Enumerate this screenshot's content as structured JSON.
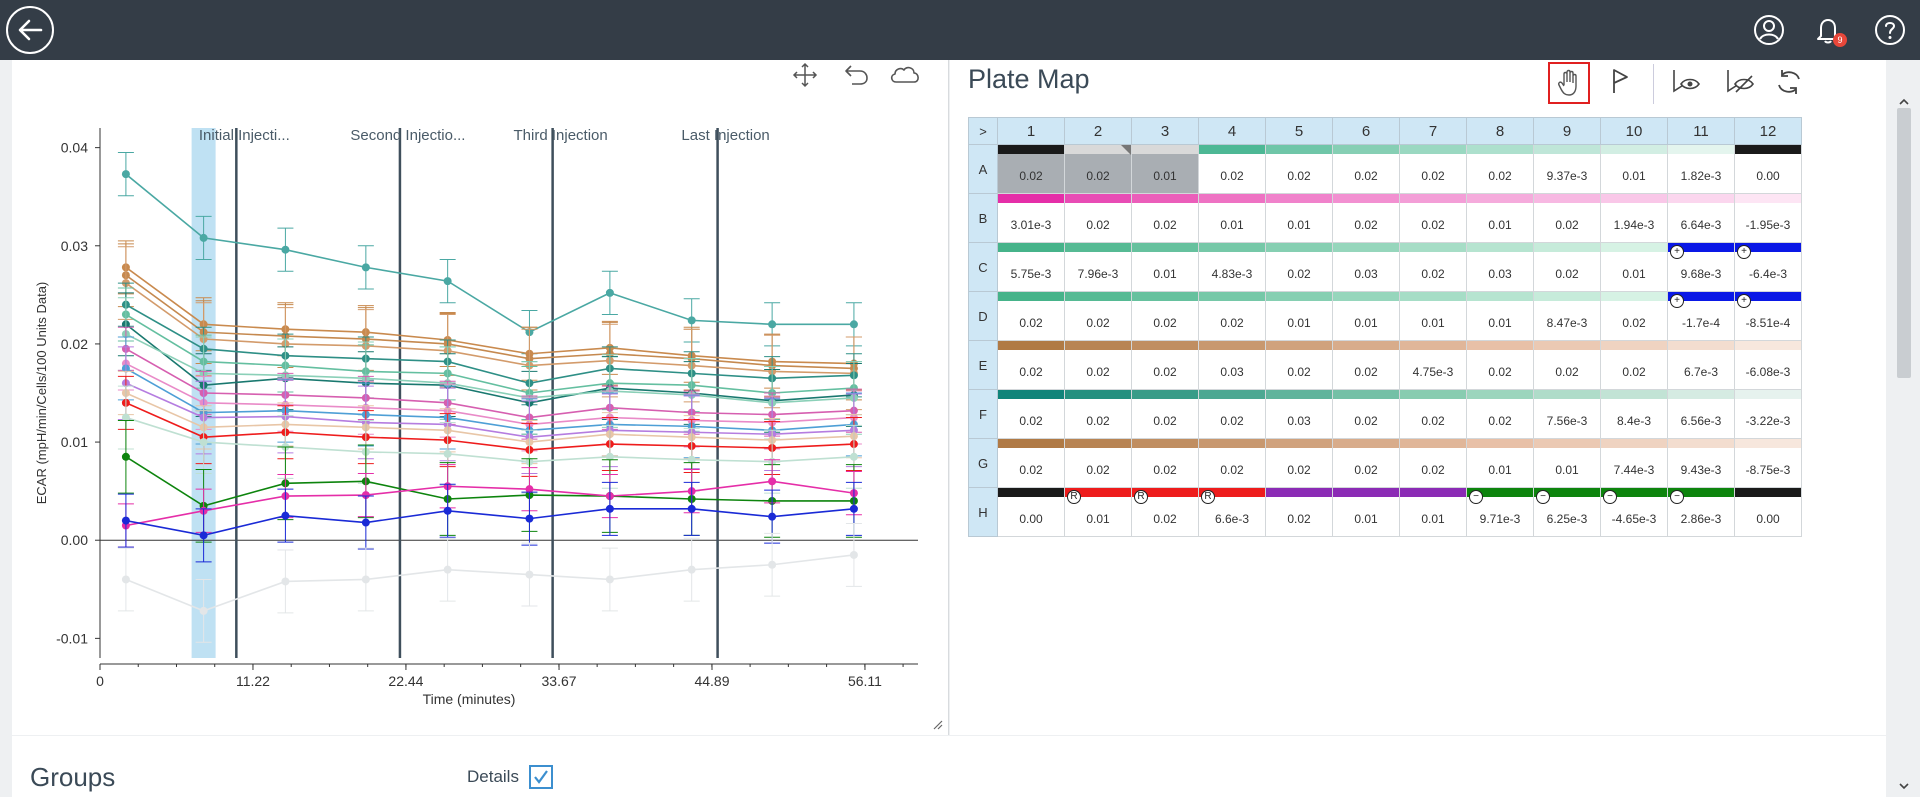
{
  "header": {
    "notification_count": "9"
  },
  "chart_toolbar": {
    "icons": [
      "move-icon",
      "undo-icon",
      "cloud-icon"
    ]
  },
  "plate_map": {
    "title": "Plate Map",
    "tools": [
      "hand-icon",
      "flag-icon",
      "show-icon",
      "hide-icon",
      "refresh-icon"
    ],
    "corner": ">",
    "columns": [
      "1",
      "2",
      "3",
      "4",
      "5",
      "6",
      "7",
      "8",
      "9",
      "10",
      "11",
      "12"
    ],
    "rows": [
      {
        "label": "A",
        "values": [
          "0.02",
          "0.02",
          "0.01",
          "0.02",
          "0.02",
          "0.02",
          "0.02",
          "0.02",
          "9.37e-3",
          "0.01",
          "1.82e-3",
          "0.00"
        ],
        "colors": [
          "#1a1a1a",
          "#d9d9d9",
          "#d9d9d9",
          "#4db895",
          "#6fc6a8",
          "#86cfb4",
          "#9ad8c1",
          "#ade0cd",
          "#bfe6d8",
          "#d2eee3",
          "#e4f5ee",
          "#1a1a1a"
        ]
      },
      {
        "label": "B",
        "values": [
          "3.01e-3",
          "0.02",
          "0.02",
          "0.01",
          "0.01",
          "0.02",
          "0.02",
          "0.01",
          "0.02",
          "1.94e-3",
          "6.64e-3",
          "-1.95e-3"
        ],
        "colors": [
          "#e52ea8",
          "#e84cb5",
          "#eb5eba",
          "#ee72c3",
          "#f082cb",
          "#f290d1",
          "#f39ed7",
          "#f5abdc",
          "#f7b8e2",
          "#f9c7e8",
          "#fbd6ee",
          "#fde5f4"
        ]
      },
      {
        "label": "C",
        "values": [
          "5.75e-3",
          "7.96e-3",
          "0.01",
          "4.83e-3",
          "0.02",
          "0.03",
          "0.02",
          "0.03",
          "0.02",
          "0.01",
          "9.68e-3",
          "-6.4e-3"
        ],
        "colors": [
          "#46b38a",
          "#56ba94",
          "#66c19e",
          "#76c8a8",
          "#86cfb2",
          "#96d6bc",
          "#a6ddc6",
          "#b6e4d0",
          "#c6ebda",
          "#d6f2e4",
          "#0a18e6",
          "#0a18e6"
        ]
      },
      {
        "label": "D",
        "values": [
          "0.02",
          "0.02",
          "0.02",
          "0.02",
          "0.01",
          "0.01",
          "0.01",
          "0.01",
          "8.47e-3",
          "0.02",
          "-1.7e-4",
          "-8.51e-4"
        ],
        "colors": [
          "#46b38a",
          "#56ba94",
          "#66c19e",
          "#76c8a8",
          "#86cfb2",
          "#96d6bc",
          "#a6ddc6",
          "#b6e4d0",
          "#c6ebda",
          "#d6f2e4",
          "#0a18e6",
          "#0a18e6"
        ]
      },
      {
        "label": "E",
        "values": [
          "0.02",
          "0.02",
          "0.02",
          "0.03",
          "0.02",
          "0.02",
          "4.75e-3",
          "0.02",
          "0.02",
          "0.02",
          "6.7e-3",
          "-6.08e-3"
        ],
        "colors": [
          "#b07a45",
          "#b88453",
          "#c08e61",
          "#c8986f",
          "#d0a27d",
          "#d8ac8b",
          "#e0b699",
          "#e8c0a7",
          "#ebc9b3",
          "#efd3c1",
          "#f3ddcf",
          "#f7e7dd"
        ]
      },
      {
        "label": "F",
        "values": [
          "0.02",
          "0.02",
          "0.02",
          "0.02",
          "0.03",
          "0.02",
          "0.02",
          "0.02",
          "7.56e-3",
          "8.4e-3",
          "6.56e-3",
          "-3.22e-3"
        ],
        "colors": [
          "#10847a",
          "#24907f",
          "#389c88",
          "#4ca892",
          "#60b49c",
          "#74c0a6",
          "#88ccb0",
          "#9cd5bd",
          "#afdcc9",
          "#c2e3d5",
          "#d5ebe2",
          "#e6f2ee"
        ]
      },
      {
        "label": "G",
        "values": [
          "0.02",
          "0.02",
          "0.02",
          "0.02",
          "0.02",
          "0.02",
          "0.02",
          "0.01",
          "0.01",
          "7.44e-3",
          "9.43e-3",
          "-8.75e-3"
        ],
        "colors": [
          "#b07a45",
          "#b88453",
          "#c08e61",
          "#c8986f",
          "#d0a27d",
          "#d8ac8b",
          "#e0b699",
          "#e8c0a7",
          "#ebc9b3",
          "#efd3c1",
          "#f3ddcf",
          "#f7e7dd"
        ]
      },
      {
        "label": "H",
        "values": [
          "0.00",
          "0.01",
          "0.02",
          "6.6e-3",
          "0.02",
          "0.01",
          "0.01",
          "9.71e-3",
          "6.25e-3",
          "-4.65e-3",
          "2.86e-3",
          "0.00"
        ],
        "colors": [
          "#1a1a1a",
          "#ee1c1c",
          "#ee1c1c",
          "#ee1c1c",
          "#8b2bb5",
          "#8b2bb5",
          "#8b2bb5",
          "#0d840d",
          "#0d840d",
          "#0d840d",
          "#0d840d",
          "#1a1a1a"
        ]
      }
    ]
  },
  "chart_data": {
    "type": "line",
    "xlabel": "Time (minutes)",
    "ylabel": "ECAR (mpH/min/Cells/100 Units Data)",
    "xlim": [
      0,
      60
    ],
    "ylim": [
      -0.012,
      0.042
    ],
    "x_ticks": [
      0,
      11.22,
      22.44,
      33.67,
      44.89,
      56.11
    ],
    "y_ticks": [
      -0.01,
      0.0,
      0.01,
      0.02,
      0.03,
      0.04
    ],
    "y_tick_labels": [
      "-0.01",
      "0.00",
      "0.01",
      "0.02",
      "0.03",
      "0.04"
    ],
    "injections": [
      {
        "label": "Initial Injecti...",
        "x": 10.0
      },
      {
        "label": "Second Injectio...",
        "x": 22.0
      },
      {
        "label": "Third Injection",
        "x": 33.2
      },
      {
        "label": "Last Injection",
        "x": 45.3
      }
    ],
    "selected_timepoint": {
      "x": 7.6
    },
    "x": [
      1.9,
      7.6,
      13.6,
      19.5,
      25.5,
      31.5,
      37.4,
      43.4,
      49.3,
      55.3
    ],
    "series": [
      {
        "color": "#4aa8a3",
        "values": [
          0.0373,
          0.0308,
          0.0296,
          0.0278,
          0.0264,
          0.0212,
          0.0252,
          0.0224,
          0.022,
          0.022
        ]
      },
      {
        "color": "#c98a4e",
        "values": [
          0.0278,
          0.022,
          0.0215,
          0.0212,
          0.0204,
          0.019,
          0.0196,
          0.0188,
          0.0182,
          0.018
        ]
      },
      {
        "color": "#c5894f",
        "values": [
          0.027,
          0.0212,
          0.0208,
          0.0205,
          0.02,
          0.0185,
          0.019,
          0.0185,
          0.0178,
          0.0175
        ]
      },
      {
        "color": "#d39b6b",
        "values": [
          0.0262,
          0.0205,
          0.02,
          0.0198,
          0.0193,
          0.0178,
          0.0183,
          0.0178,
          0.0172,
          0.017
        ]
      },
      {
        "color": "#2e8f86",
        "values": [
          0.024,
          0.0195,
          0.0188,
          0.0185,
          0.0182,
          0.016,
          0.0175,
          0.017,
          0.0165,
          0.0168
        ]
      },
      {
        "color": "#64bfa0",
        "values": [
          0.023,
          0.0182,
          0.0178,
          0.0172,
          0.017,
          0.015,
          0.016,
          0.0158,
          0.015,
          0.0155
        ]
      },
      {
        "color": "#19786f",
        "values": [
          0.022,
          0.0158,
          0.0165,
          0.016,
          0.0158,
          0.014,
          0.0155,
          0.015,
          0.0142,
          0.0148
        ]
      },
      {
        "color": "#8bd0b8",
        "values": [
          0.021,
          0.017,
          0.0168,
          0.0165,
          0.016,
          0.0145,
          0.0152,
          0.0148,
          0.014,
          0.0145
        ]
      },
      {
        "color": "#d65fb0",
        "values": [
          0.0195,
          0.015,
          0.0148,
          0.0145,
          0.014,
          0.0125,
          0.0135,
          0.013,
          0.0128,
          0.0132
        ]
      },
      {
        "color": "#e98bc8",
        "values": [
          0.018,
          0.014,
          0.0138,
          0.0135,
          0.0132,
          0.0118,
          0.0125,
          0.0122,
          0.012,
          0.0125
        ]
      },
      {
        "color": "#4e9fd6",
        "values": [
          0.0175,
          0.013,
          0.0132,
          0.0128,
          0.0125,
          0.0112,
          0.0118,
          0.0116,
          0.0112,
          0.0118
        ]
      },
      {
        "color": "#b57de0",
        "values": [
          0.016,
          0.0125,
          0.0126,
          0.012,
          0.0118,
          0.0105,
          0.0112,
          0.011,
          0.0108,
          0.0112
        ]
      },
      {
        "color": "#e8c6a7",
        "values": [
          0.015,
          0.0115,
          0.0118,
          0.0115,
          0.0112,
          0.01,
          0.0108,
          0.0105,
          0.0102,
          0.0106
        ]
      },
      {
        "color": "#ee1c1c",
        "values": [
          0.014,
          0.0105,
          0.011,
          0.0105,
          0.0102,
          0.0092,
          0.0098,
          0.0096,
          0.0094,
          0.0098
        ]
      },
      {
        "color": "#bfe0d2",
        "values": [
          0.0125,
          0.01,
          0.0095,
          0.009,
          0.0088,
          0.008,
          0.0085,
          0.0082,
          0.008,
          0.0085
        ]
      },
      {
        "color": "#0d840d",
        "values": [
          0.0085,
          0.0035,
          0.0058,
          0.006,
          0.0042,
          0.0046,
          0.0045,
          0.0042,
          0.004,
          0.004
        ]
      },
      {
        "color": "#e52ea8",
        "values": [
          0.0015,
          0.003,
          0.0045,
          0.0046,
          0.0055,
          0.0052,
          0.0045,
          0.005,
          0.006,
          0.0048
        ]
      },
      {
        "color": "#1a2ad6",
        "values": [
          0.002,
          0.0005,
          0.0025,
          0.0018,
          0.003,
          0.0022,
          0.0032,
          0.0032,
          0.0024,
          0.0032
        ]
      },
      {
        "color": "#e3e6e8",
        "values": [
          -0.004,
          -0.0072,
          -0.0042,
          -0.004,
          -0.003,
          -0.0035,
          -0.004,
          -0.003,
          -0.0025,
          -0.0015
        ]
      }
    ]
  },
  "groups": {
    "title": "Groups",
    "details_label": "Details",
    "details_checked": true
  }
}
